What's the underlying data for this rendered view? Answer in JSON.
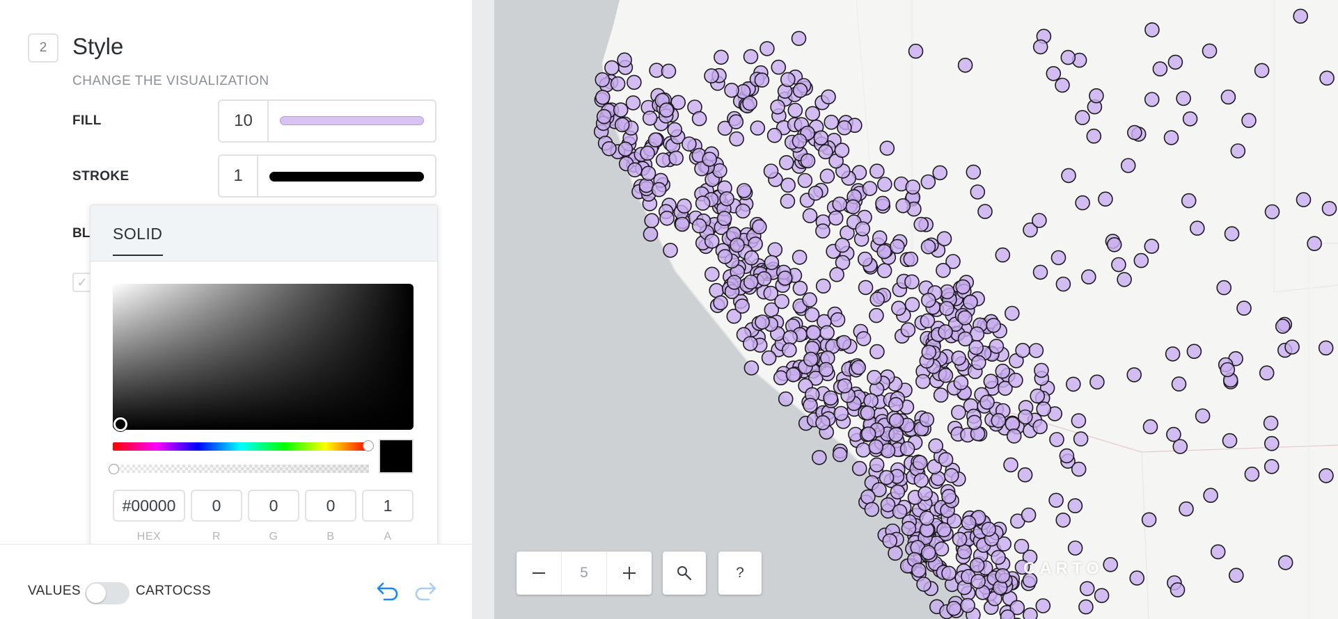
{
  "panel": {
    "step_number": "2",
    "title": "Style",
    "subtitle": "CHANGE THE VISUALIZATION",
    "fill": {
      "label": "FILL",
      "size": "10",
      "color": "#d9c3f2"
    },
    "stroke": {
      "label": "STROKE",
      "width": "1",
      "color": "#000000"
    },
    "blending_label_partial": "BL"
  },
  "picker": {
    "tab": "SOLID",
    "hex": "#00000",
    "r": "0",
    "g": "0",
    "b": "0",
    "a": "1",
    "labels": {
      "hex": "HEX",
      "r": "R",
      "g": "G",
      "b": "B",
      "a": "A"
    },
    "preview_color": "#000000"
  },
  "bottom": {
    "values_label": "VALUES",
    "cartocss_label": "CARTOCSS",
    "toggle_on": false,
    "accent_color": "#1785fb"
  },
  "map": {
    "zoom_level": "5",
    "zoom_out_icon": "minus-icon",
    "zoom_in_icon": "plus-icon",
    "search_icon": "search-icon",
    "help_label": "?",
    "attribution": "CARTO",
    "point_fill": "#c9aef0",
    "point_stroke": "#1a1a1a"
  }
}
